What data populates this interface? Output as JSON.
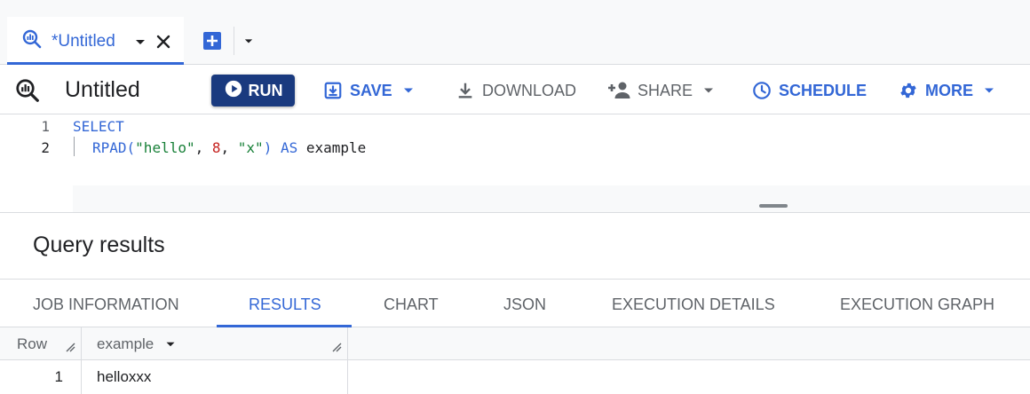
{
  "tabs": {
    "active_tab_label": "*Untitled"
  },
  "toolbar": {
    "title": "Untitled",
    "run_label": "RUN",
    "save_label": "SAVE",
    "download_label": "DOWNLOAD",
    "share_label": "SHARE",
    "schedule_label": "SCHEDULE",
    "more_label": "MORE"
  },
  "editor": {
    "line_numbers": [
      "1",
      "2"
    ],
    "line1": {
      "keyword": "SELECT"
    },
    "line2": {
      "func": "RPAD(",
      "arg1": "\"hello\"",
      "sep1": ", ",
      "arg2": "8",
      "sep2": ", ",
      "arg3": "\"x\"",
      "close": ") ",
      "as_kw": "AS",
      "alias": " example"
    }
  },
  "results": {
    "title": "Query results",
    "tabs": [
      "JOB INFORMATION",
      "RESULTS",
      "CHART",
      "JSON",
      "EXECUTION DETAILS",
      "EXECUTION GRAPH"
    ],
    "active_tab": "RESULTS",
    "columns": [
      "Row",
      "example"
    ],
    "rows": [
      {
        "row": "1",
        "example": "helloxxx"
      }
    ]
  },
  "colors": {
    "accent": "#3367d6",
    "run_button": "#1a3a7f",
    "string": "#188038",
    "number": "#c5221f"
  },
  "icons": {
    "tab": "query-icon",
    "close": "close-icon",
    "add": "add-box-icon",
    "run": "play-circle-icon",
    "save": "save-icon",
    "download": "download-icon",
    "share": "person-add-icon",
    "schedule": "clock-icon",
    "more": "gear-icon"
  }
}
